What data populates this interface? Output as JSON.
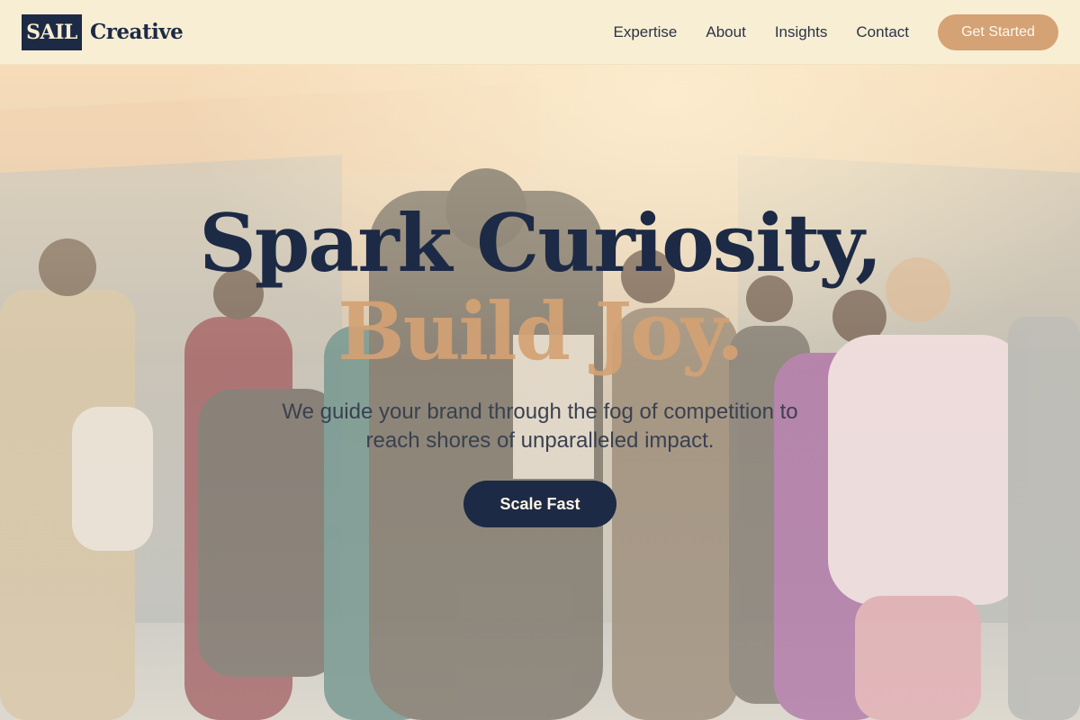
{
  "brand": {
    "logo_box_text": "SAIL",
    "logo_text": "Creative",
    "navy": "#1d2a45",
    "accent": "#d4a274",
    "background": "#f8eed3"
  },
  "nav": {
    "items": [
      {
        "label": "Expertise"
      },
      {
        "label": "About"
      },
      {
        "label": "Insights"
      },
      {
        "label": "Contact"
      }
    ],
    "cta_label": "Get Started"
  },
  "hero": {
    "headline_line1": "Spark Curiosity,",
    "headline_line2": "Build Joy.",
    "subtitle": "We guide your brand through the fog of competition to reach shores of unparalleled impact.",
    "button_label": "Scale Fast",
    "background_image": "fashion-group-photo"
  }
}
